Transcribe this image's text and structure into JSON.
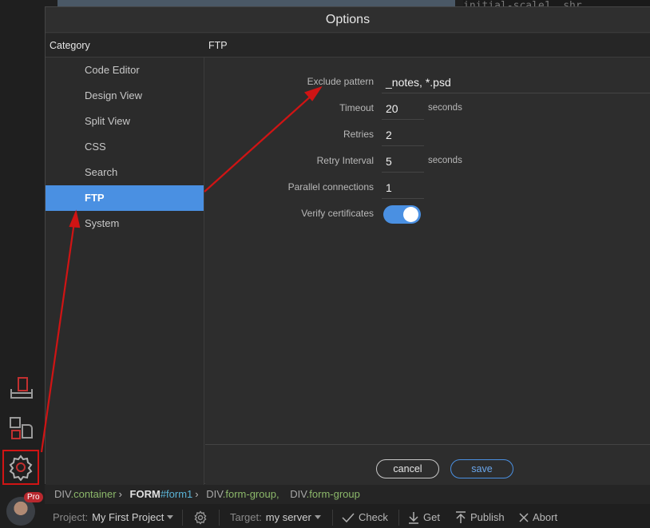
{
  "dialog": {
    "title": "Options",
    "category_header": "Category",
    "section_header": "FTP"
  },
  "categories": [
    {
      "label": "Code Editor",
      "active": false
    },
    {
      "label": "Design View",
      "active": false
    },
    {
      "label": "Split View",
      "active": false
    },
    {
      "label": "CSS",
      "active": false
    },
    {
      "label": "Search",
      "active": false
    },
    {
      "label": "FTP",
      "active": true
    },
    {
      "label": "System",
      "active": false
    }
  ],
  "ftp": {
    "exclude_pattern": {
      "label": "Exclude pattern",
      "value": "_notes, *.psd"
    },
    "timeout": {
      "label": "Timeout",
      "value": "20",
      "unit": "seconds"
    },
    "retries": {
      "label": "Retries",
      "value": "2"
    },
    "retry_interval": {
      "label": "Retry Interval",
      "value": "5",
      "unit": "seconds"
    },
    "parallel_connections": {
      "label": "Parallel connections",
      "value": "1"
    },
    "verify_certificates": {
      "label": "Verify certificates",
      "enabled": true
    }
  },
  "buttons": {
    "cancel": "cancel",
    "save": "save"
  },
  "breadcrumb": {
    "item1_tag": "DIV",
    "item1_class": ".container",
    "item2_tag": "FORM",
    "item2_id": "#form1",
    "item3_tag": "DIV",
    "item3_class": ".form-group,",
    "item4_tag": "DIV",
    "item4_class": ".form-group"
  },
  "toolbar": {
    "project_key": "Project:",
    "project_value": "My First Project",
    "target_key": "Target:",
    "target_value": "my server",
    "check": "Check",
    "get": "Get",
    "publish": "Publish",
    "abort": "Abort"
  },
  "user": {
    "badge": "Pro"
  },
  "background": {
    "code_snippet": "initial-scale1, shr"
  },
  "colors": {
    "accent": "#4a90e2",
    "annotation": "#d01414"
  },
  "icons": {
    "rail_top": "file-download-icon",
    "rail_middle": "extensions-icon",
    "rail_bottom": "gear-icon"
  }
}
